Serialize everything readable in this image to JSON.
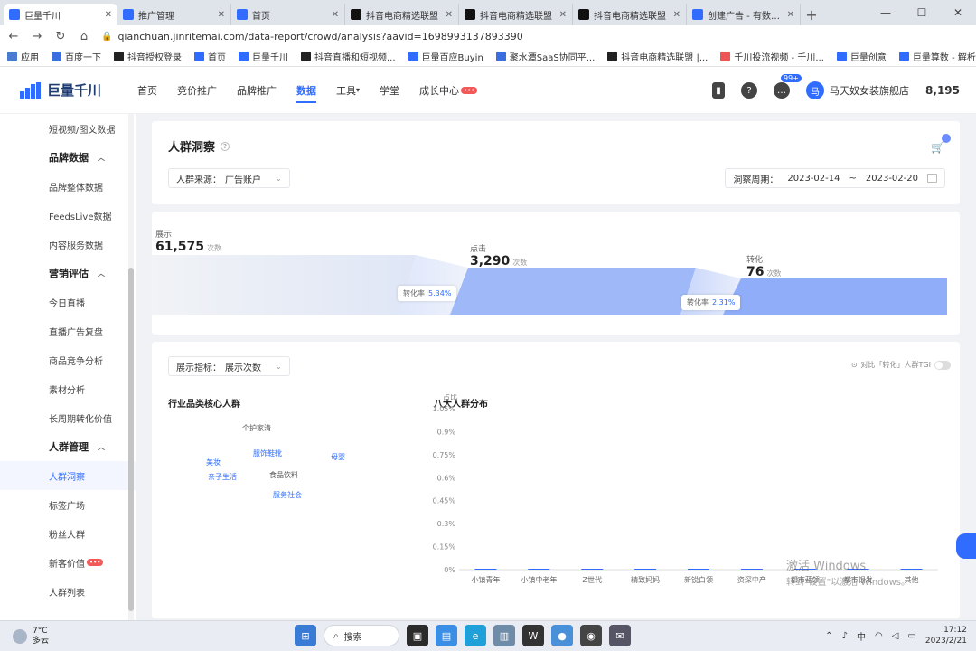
{
  "browser": {
    "tabs": [
      {
        "title": "巨量千川",
        "color": "#2f6cff",
        "active": true
      },
      {
        "title": "推广管理",
        "color": "#2f6cff",
        "active": false
      },
      {
        "title": "首页",
        "color": "#2f6cff",
        "active": false
      },
      {
        "title": "抖音电商精选联盟",
        "color": "#111111",
        "active": false
      },
      {
        "title": "抖音电商精选联盟",
        "color": "#111111",
        "active": false
      },
      {
        "title": "抖音电商精选联盟",
        "color": "#111111",
        "active": false
      },
      {
        "title": "创建广告 - 有数 - 有",
        "color": "#2f6cff",
        "active": false
      }
    ],
    "url": "qianchuan.jinritemai.com/data-report/crowd/analysis?aavid=1698993137893390",
    "bookmarks": [
      "应用",
      "百度一下",
      "抖音授权登录",
      "首页",
      "巨量千川",
      "抖音直播和短视频...",
      "巨量百应Buyin",
      "聚水潭SaaS协同平...",
      "抖音电商精选联盟 |...",
      "千川投流视频 - 千川...",
      "巨量创意",
      "巨量算数 - 解析内容..."
    ]
  },
  "header": {
    "logo": "巨量千川",
    "nav": [
      {
        "label": "首页",
        "active": false
      },
      {
        "label": "竞价推广",
        "active": false
      },
      {
        "label": "品牌推广",
        "active": false
      },
      {
        "label": "数据",
        "active": true
      },
      {
        "label": "工具",
        "active": false
      },
      {
        "label": "学堂",
        "active": false
      },
      {
        "label": "成长中心",
        "active": false
      }
    ],
    "msg_count": "99+",
    "account_initial": "马",
    "account_name": "马天奴女装旗舰店",
    "balance": "8,195"
  },
  "sidebar": {
    "items": [
      {
        "label": "短视频/图文数据",
        "type": "item"
      },
      {
        "label": "品牌数据",
        "type": "group"
      },
      {
        "label": "品牌整体数据",
        "type": "item"
      },
      {
        "label": "FeedsLive数据",
        "type": "item"
      },
      {
        "label": "内容服务数据",
        "type": "item"
      },
      {
        "label": "营销评估",
        "type": "group"
      },
      {
        "label": "今日直播",
        "type": "item"
      },
      {
        "label": "直播广告复盘",
        "type": "item"
      },
      {
        "label": "商品竞争分析",
        "type": "item"
      },
      {
        "label": "素材分析",
        "type": "item"
      },
      {
        "label": "长周期转化价值",
        "type": "item"
      },
      {
        "label": "人群管理",
        "type": "group"
      },
      {
        "label": "人群洞察",
        "type": "item",
        "active": true
      },
      {
        "label": "标签广场",
        "type": "item"
      },
      {
        "label": "粉丝人群",
        "type": "item"
      },
      {
        "label": "新客价值",
        "type": "item"
      },
      {
        "label": "人群列表",
        "type": "item"
      }
    ]
  },
  "page": {
    "title": "人群洞察",
    "source_label": "人群来源：",
    "source_value": "广告账户",
    "period_label": "洞察周期：",
    "date_start": "2023-02-14",
    "date_sep": "~",
    "date_end": "2023-02-20"
  },
  "funnel": {
    "stages": [
      {
        "label": "展示",
        "value": "61,575",
        "unit": "次数"
      },
      {
        "label": "点击",
        "value": "3,290",
        "unit": "次数"
      },
      {
        "label": "转化",
        "value": "76",
        "unit": "次数"
      }
    ],
    "rates": [
      {
        "label": "转化率",
        "value": "5.34%"
      },
      {
        "label": "转化率",
        "value": "2.31%"
      }
    ]
  },
  "metrics": {
    "indicator_label": "展示指标：",
    "indicator_value": "展示次数",
    "compare_text": "对比「转化」人群TGI",
    "core_title": "行业品类核心人群",
    "core_words": [
      {
        "text": "个护家清",
        "style": "gray"
      },
      {
        "text": "服饰鞋靴",
        "style": "blue"
      },
      {
        "text": "食品饮料",
        "style": "gray"
      },
      {
        "text": "服务社会",
        "style": "blue"
      },
      {
        "text": "亲子生活",
        "style": "blue"
      },
      {
        "text": "美妆",
        "style": "blue"
      },
      {
        "text": "母婴",
        "style": "blue"
      }
    ],
    "dist_title": "八大人群分布"
  },
  "chart_data": {
    "type": "bar",
    "title": "八大人群分布",
    "ylabel": "占比",
    "yticks": [
      "1.05%",
      "0.9%",
      "0.75%",
      "0.6%",
      "0.45%",
      "0.3%",
      "0.15%",
      "0%"
    ],
    "ylim": [
      0,
      1.05
    ],
    "categories": [
      "小镇青年",
      "小镇中老年",
      "Z世代",
      "精致妈妈",
      "新锐白领",
      "资深中产",
      "都市蓝领",
      "都市银发",
      "其他"
    ],
    "series": [
      {
        "values": [
          0.0,
          0.0,
          0.0,
          0.0,
          0.0,
          0.0,
          0.0,
          0.0,
          0.0
        ]
      }
    ],
    "grid": false,
    "colors": {
      "bar": "#2f6cff"
    }
  },
  "watermark": {
    "line1": "激活 Windows",
    "line2": "转到\"设置\"以激活 Windows。"
  },
  "taskbar": {
    "temp": "7°C",
    "weather": "多云",
    "search": "搜索",
    "ime": "中",
    "time": "17:12",
    "date": "2023/2/21"
  }
}
